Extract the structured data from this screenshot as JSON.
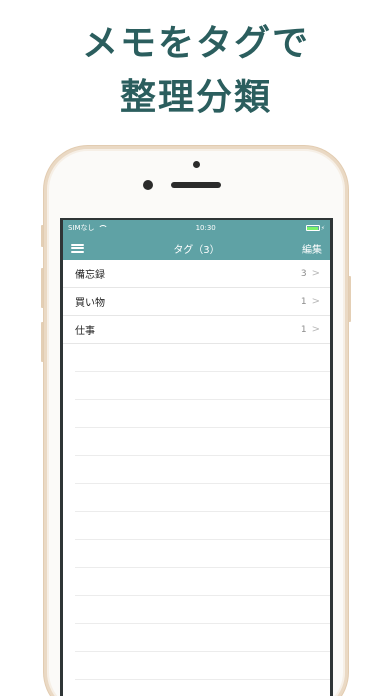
{
  "headline": {
    "line1": "メモをタグで",
    "line2": "整理分類"
  },
  "colors": {
    "headline": "#2b5e5e",
    "nav_bar": "#5fa2a5",
    "phone_frame": "#ead9c4",
    "battery_fill": "#7cf36a"
  },
  "status_bar": {
    "carrier": "SIMなし",
    "time": "10:30",
    "wifi_icon": "wifi-icon",
    "battery_icon": "battery-icon"
  },
  "nav": {
    "menu_icon": "hamburger-menu-icon",
    "title": "タグ（3）",
    "edit_label": "編集"
  },
  "tags": [
    {
      "name": "備忘録",
      "count": "3",
      "chevron": ">"
    },
    {
      "name": "買い物",
      "count": "1",
      "chevron": ">"
    },
    {
      "name": "仕事",
      "count": "1",
      "chevron": ">"
    }
  ]
}
